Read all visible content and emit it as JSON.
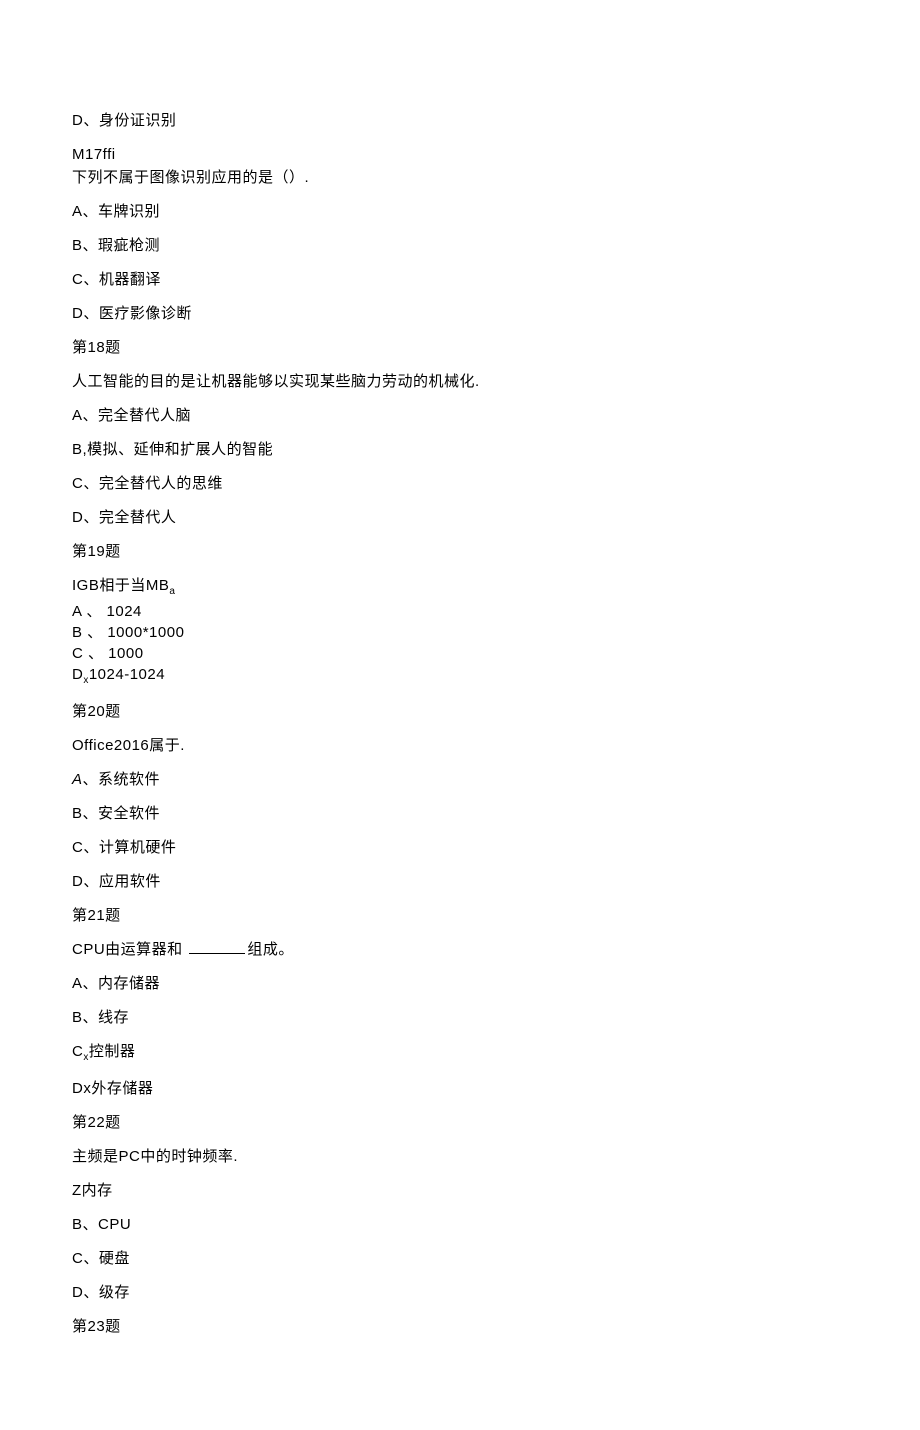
{
  "lines": [
    "D、身份证识别",
    "M17ffi",
    "下列不属于图像识别应用的是（）.",
    "A、车牌识别",
    "B、瑕疵枪测",
    "C、机器翻译",
    "D、医疗影像诊断"
  ],
  "q18": {
    "header": "第18题",
    "stem": "人工智能的目的是让机器能够以实现某些脑力劳动的机械化.",
    "options": [
      "A、完全替代人脑",
      "B,模拟、延伸和扩展人的智能",
      "C、完全替代人的思维",
      "D、完全替代人"
    ]
  },
  "q19": {
    "header": "第19题",
    "stem_prefix": "IGB相于当MB",
    "stem_sub": "a",
    "options": [
      "A 、 1024",
      "B 、 1000*1000",
      "C 、 1000",
      "D"
    ],
    "opt_d_sub": "x",
    "opt_d_tail": "1024-1024"
  },
  "q20": {
    "header": "第20题",
    "stem": "Office2016属于.",
    "opt_a_prefix": "A",
    "opt_a_tail": "、系统软件",
    "options_rest": [
      "B、安全软件",
      "C、计算机硬件",
      "D、应用软件"
    ]
  },
  "q21": {
    "header": "第21题",
    "stem_prefix": "CPU由运算器和",
    "stem_suffix": "组成。",
    "options": [
      "A、内存储器",
      "B、线存"
    ],
    "opt_c_prefix": "C",
    "opt_c_sub": "x",
    "opt_c_tail": "控制器",
    "opt_d": "Dx外存储器"
  },
  "q22": {
    "header": "第22题",
    "stem": "主频是PC中的时钟频率.",
    "options": [
      "Z内存",
      "B、CPU",
      "C、硬盘",
      "D、级存"
    ]
  },
  "q23": {
    "header": "第23题"
  }
}
